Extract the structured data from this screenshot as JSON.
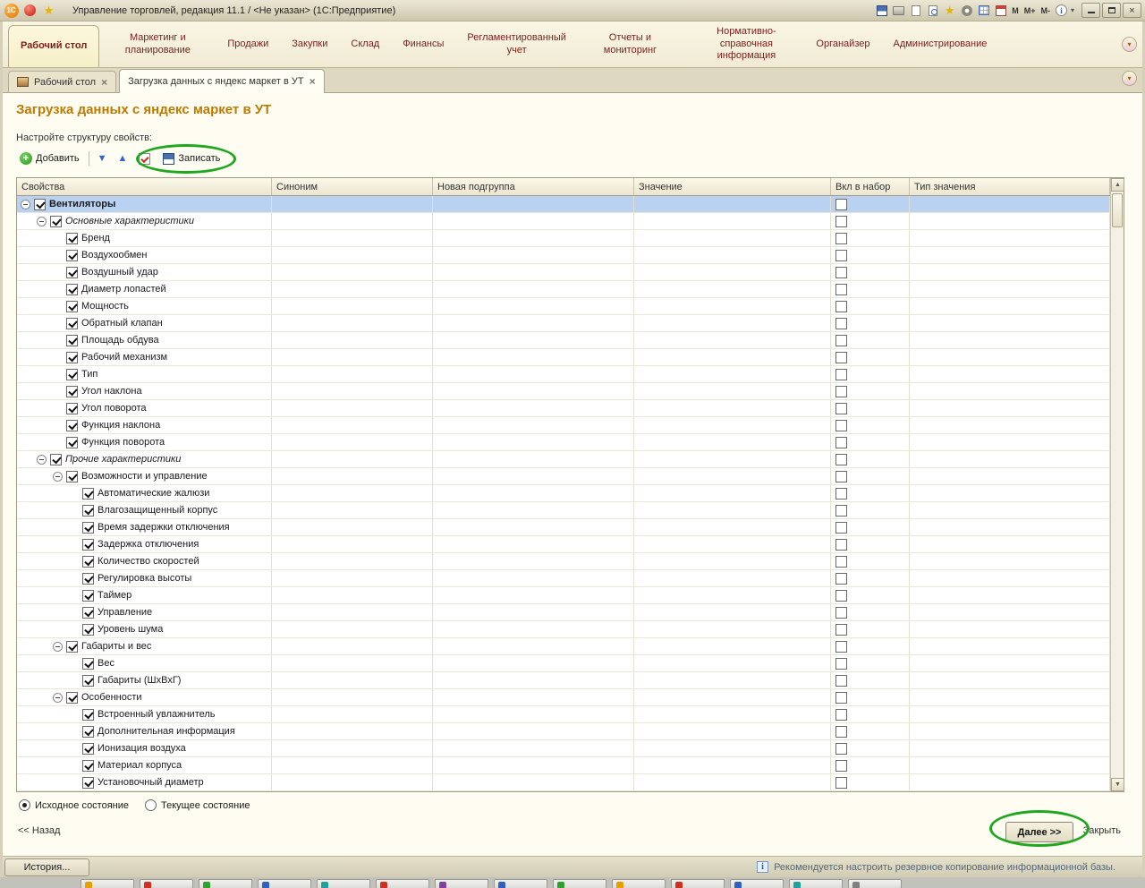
{
  "window": {
    "title": "Управление торговлей, редакция 11.1 / <Не указан>  (1С:Предприятие)",
    "memory": [
      "M",
      "M+",
      "M-"
    ]
  },
  "sections": {
    "items": [
      {
        "label": "Рабочий стол",
        "active": true
      },
      {
        "label": "Маркетинг и планирование",
        "active": false
      },
      {
        "label": "Продажи",
        "active": false
      },
      {
        "label": "Закупки",
        "active": false
      },
      {
        "label": "Склад",
        "active": false
      },
      {
        "label": "Финансы",
        "active": false
      },
      {
        "label": "Регламентированный учет",
        "active": false
      },
      {
        "label": "Отчеты и мониторинг",
        "active": false
      },
      {
        "label": "Нормативно-справочная информация",
        "active": false
      },
      {
        "label": "Органайзер",
        "active": false
      },
      {
        "label": "Администрирование",
        "active": false
      }
    ]
  },
  "doc_tabs": [
    {
      "label": "Рабочий стол",
      "active": false
    },
    {
      "label": "Загрузка данных с яндекс маркет в УТ",
      "active": true
    }
  ],
  "page": {
    "title": "Загрузка данных с яндекс маркет в УТ",
    "hint": "Настройте структуру свойств:"
  },
  "toolbar": {
    "add_label": "Добавить",
    "save_label": "Записать"
  },
  "table": {
    "columns": [
      "Свойства",
      "Синоним",
      "Новая подгруппа",
      "Значение",
      "Вкл в набор",
      "Тип значения"
    ],
    "rows": [
      {
        "label": "Вентиляторы",
        "level": 0,
        "expand": true,
        "bold": true,
        "selected": true
      },
      {
        "label": "Основные характеристики",
        "level": 1,
        "expand": true,
        "italic": true
      },
      {
        "label": "Бренд",
        "level": 2
      },
      {
        "label": "Воздухообмен",
        "level": 2
      },
      {
        "label": "Воздушный удар",
        "level": 2
      },
      {
        "label": "Диаметр лопастей",
        "level": 2
      },
      {
        "label": "Мощность",
        "level": 2
      },
      {
        "label": "Обратный клапан",
        "level": 2
      },
      {
        "label": "Площадь обдува",
        "level": 2
      },
      {
        "label": "Рабочий механизм",
        "level": 2
      },
      {
        "label": "Тип",
        "level": 2
      },
      {
        "label": "Угол наклона",
        "level": 2
      },
      {
        "label": "Угол поворота",
        "level": 2
      },
      {
        "label": "Функция наклона",
        "level": 2
      },
      {
        "label": "Функция поворота",
        "level": 2
      },
      {
        "label": "Прочие характеристики",
        "level": 1,
        "expand": true,
        "italic": true
      },
      {
        "label": "Возможности и управление",
        "level": 2,
        "expand": true
      },
      {
        "label": "Автоматические жалюзи",
        "level": 3
      },
      {
        "label": "Влагозащищенный корпус",
        "level": 3
      },
      {
        "label": "Время задержки отключения",
        "level": 3
      },
      {
        "label": "Задержка отключения",
        "level": 3
      },
      {
        "label": "Количество скоростей",
        "level": 3
      },
      {
        "label": "Регулировка высоты",
        "level": 3
      },
      {
        "label": "Таймер",
        "level": 3
      },
      {
        "label": "Управление",
        "level": 3
      },
      {
        "label": "Уровень шума",
        "level": 3
      },
      {
        "label": "Габариты и вес",
        "level": 2,
        "expand": true
      },
      {
        "label": "Вес",
        "level": 3
      },
      {
        "label": "Габариты (ШхВхГ)",
        "level": 3
      },
      {
        "label": "Особенности",
        "level": 2,
        "expand": true
      },
      {
        "label": "Встроенный увлажнитель",
        "level": 3
      },
      {
        "label": "Дополнительная информация",
        "level": 3
      },
      {
        "label": "Ионизация воздуха",
        "level": 3
      },
      {
        "label": "Материал корпуса",
        "level": 3
      },
      {
        "label": "Установочный диаметр",
        "level": 3
      }
    ]
  },
  "footer": {
    "radio_initial": "Исходное состояние",
    "radio_current": "Текущее состояние",
    "back_label": "<< Назад",
    "next_label": "Далее >>",
    "close_label": "Закрыть"
  },
  "statusbar": {
    "history_label": "История...",
    "message": "Рекомендуется настроить резервное копирование информационной базы."
  },
  "colors": {
    "accent_title": "#bd7a00",
    "section_text": "#7d1c1c",
    "selected_row": "#b9d2f2",
    "annotation": "#1fa81f"
  }
}
